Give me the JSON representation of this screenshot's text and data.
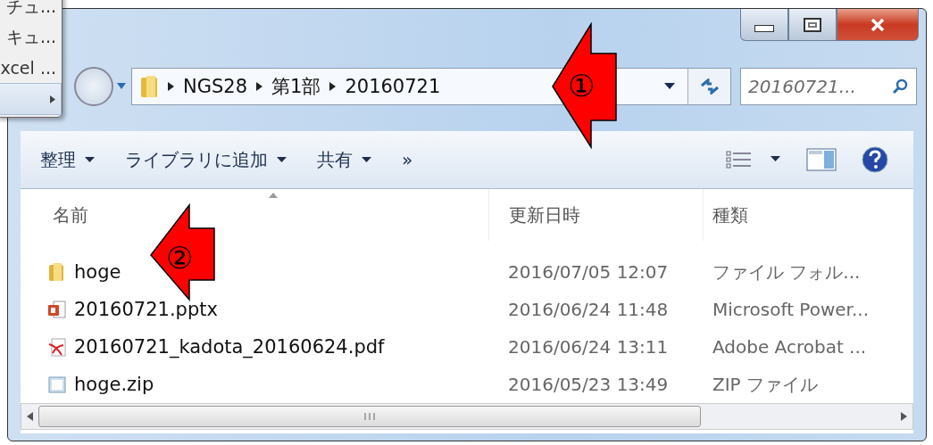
{
  "background_menu": {
    "items": [
      {
        "label": "チュ...",
        "selected": false
      },
      {
        "label": "キュ...",
        "selected": false
      },
      {
        "label": "xcel ...",
        "selected": false
      },
      {
        "selected": true,
        "submenu": true
      }
    ]
  },
  "address_bar": {
    "path": [
      "NGS28",
      "第1部",
      "20160721"
    ]
  },
  "search": {
    "placeholder": "20160721..."
  },
  "toolbar": {
    "items": [
      {
        "label": "整理",
        "dropdown": true
      },
      {
        "label": "ライブラリに追加",
        "dropdown": true
      },
      {
        "label": "共有",
        "dropdown": true
      },
      {
        "label": "»",
        "dropdown": false
      }
    ]
  },
  "columns": [
    "名前",
    "更新日時",
    "種類"
  ],
  "files": [
    {
      "kind": "folder",
      "name": "hoge",
      "modified": "2016/07/05 12:07",
      "type": "ファイル フォル..."
    },
    {
      "kind": "pptx",
      "name": "20160721.pptx",
      "modified": "2016/06/24 11:48",
      "type": "Microsoft Power..."
    },
    {
      "kind": "pdf",
      "name": "20160721_kadota_20160624.pdf",
      "modified": "2016/06/24 13:11",
      "type": "Adobe Acrobat ..."
    },
    {
      "kind": "zip",
      "name": "hoge.zip",
      "modified": "2016/05/23 13:49",
      "type": "ZIP ファイル"
    }
  ],
  "annotations": [
    {
      "label": "①"
    },
    {
      "label": "②"
    }
  ]
}
